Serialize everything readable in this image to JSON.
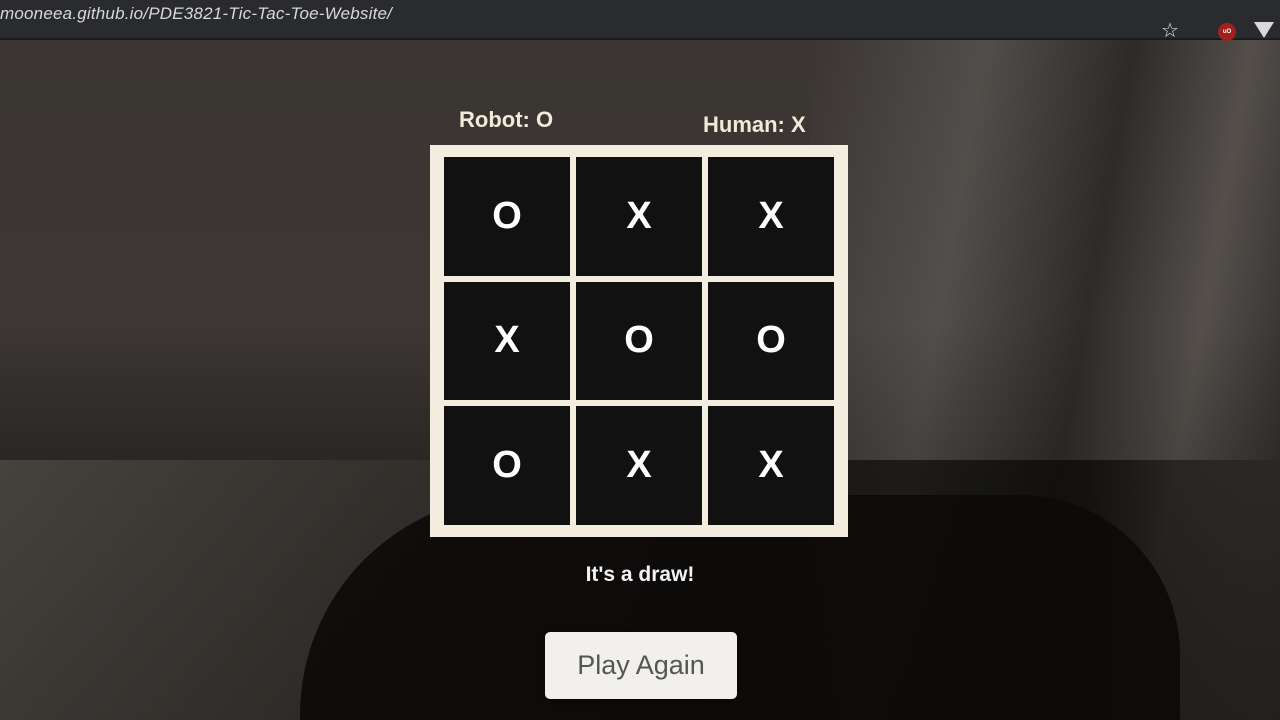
{
  "browser": {
    "url": "mooneea.github.io/PDE3821-Tic-Tac-Toe-Website/",
    "icons": [
      "star-icon",
      "ublock-icon",
      "extension-icon"
    ]
  },
  "scoreboard": {
    "robot": "Robot: O",
    "human": "Human: X"
  },
  "board": {
    "cells": [
      "O",
      "X",
      "X",
      "X",
      "O",
      "O",
      "O",
      "X",
      "X"
    ]
  },
  "status": "It's a draw!",
  "play_again_label": "Play Again",
  "colors": {
    "board_frame": "#f2eddf",
    "cell_background": "#111111",
    "mark": "#ffffff",
    "button": "#f2f0ec"
  }
}
